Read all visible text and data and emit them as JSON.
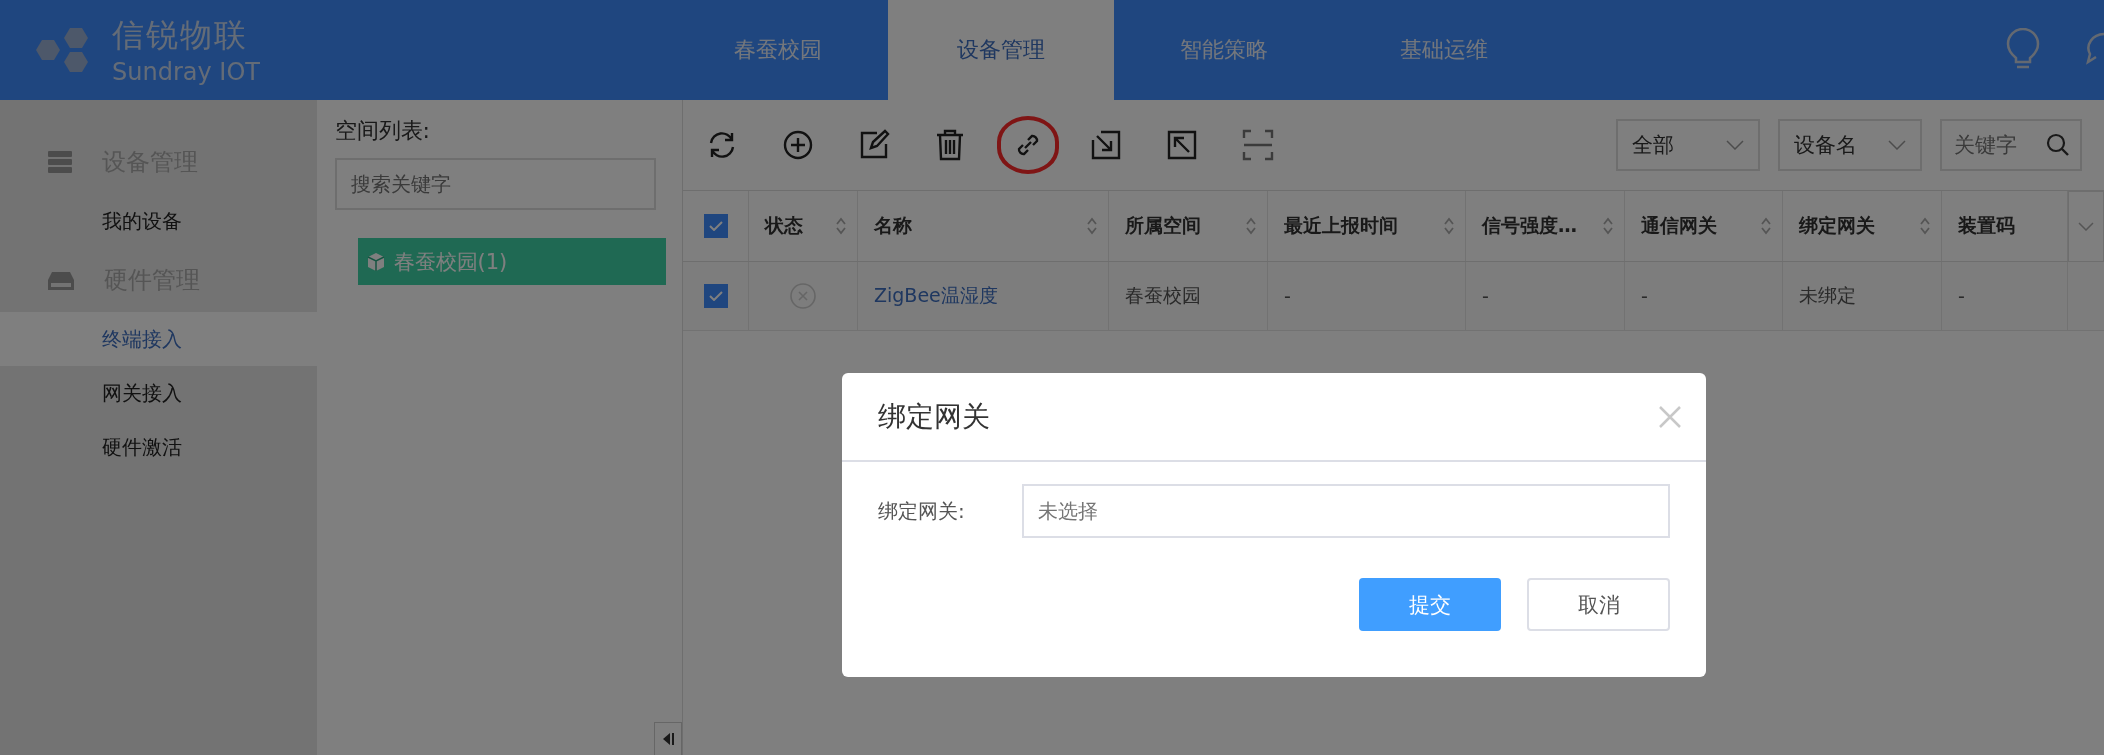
{
  "header": {
    "brand": "信锐物联",
    "brand_sub": "Sundray IOT",
    "nav": [
      {
        "label": "春蚕校园",
        "selected": false
      },
      {
        "label": "设备管理",
        "selected": true
      },
      {
        "label": "智能策略",
        "selected": false
      },
      {
        "label": "基础运维",
        "selected": false
      }
    ]
  },
  "sidebar": {
    "groups": [
      {
        "label": "设备管理",
        "items": [
          {
            "label": "我的设备",
            "selected": false
          }
        ]
      },
      {
        "label": "硬件管理",
        "items": [
          {
            "label": "终端接入",
            "selected": true
          },
          {
            "label": "网关接入",
            "selected": false
          },
          {
            "label": "硬件激活",
            "selected": false
          }
        ]
      }
    ]
  },
  "space_panel": {
    "title": "空间列表:",
    "search": {
      "placeholder": "搜索关键字"
    },
    "tree": [
      {
        "label": "春蚕校园(1)",
        "selected": true
      }
    ]
  },
  "toolbar": {
    "tools": [
      {
        "kind": "refresh",
        "highlighted": false
      },
      {
        "kind": "add",
        "highlighted": false
      },
      {
        "kind": "edit",
        "highlighted": false
      },
      {
        "kind": "delete",
        "highlighted": false
      },
      {
        "kind": "link",
        "highlighted": true
      },
      {
        "kind": "import",
        "highlighted": false
      },
      {
        "kind": "export",
        "highlighted": false
      },
      {
        "kind": "scan",
        "highlighted": false
      }
    ],
    "filter_1": "全部",
    "filter_2": "设备名",
    "keyword": {
      "placeholder": "关键字"
    }
  },
  "table": {
    "all_checked": true,
    "columns": [
      {
        "label": "状态",
        "sortable": true
      },
      {
        "label": "名称",
        "sortable": true
      },
      {
        "label": "所属空间",
        "sortable": true
      },
      {
        "label": "最近上报时间",
        "sortable": true
      },
      {
        "label": "信号强度…",
        "sortable": true
      },
      {
        "label": "通信网关",
        "sortable": true
      },
      {
        "label": "绑定网关",
        "sortable": true
      },
      {
        "label": "装置码",
        "sortable": false
      }
    ],
    "rows": [
      {
        "checked": true,
        "online": false,
        "cells": [
          "",
          "ZigBee温湿度",
          "春蚕校园",
          "-",
          "-",
          "-",
          "未绑定",
          "-"
        ]
      }
    ]
  },
  "dialog": {
    "title": "绑定网关",
    "field_label": "绑定网关:",
    "field": {
      "placeholder": "未选择"
    },
    "submit": "提交",
    "cancel": "取消"
  }
}
